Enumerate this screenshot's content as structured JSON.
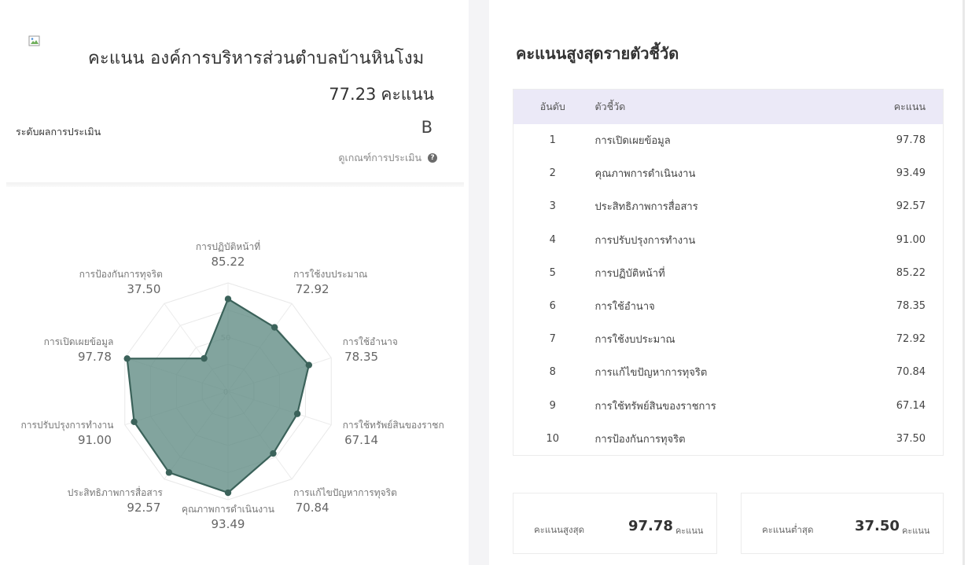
{
  "left": {
    "org_title": "คะแนน องค์การบริหารส่วนตำบลบ้านหินโงม",
    "score_value": "77.23",
    "score_unit": "คะแนน",
    "level_label": "ระดับผลการประเมิน",
    "level_value": "B",
    "criteria_link": "ดูเกณฑ์การประเมิน",
    "help_icon": "?"
  },
  "chart_data": {
    "type": "radar",
    "axes": [
      "การปฏิบัติหน้าที่",
      "การใช้งบประมาณ",
      "การใช้อำนาจ",
      "การใช้ทรัพย์สินของราชก",
      "การแก้ไขปัญหาการทุจริต",
      "คุณภาพการดำเนินงาน",
      "ประสิทธิภาพการสื่อสาร",
      "การปรับปรุงการทำงาน",
      "การเปิดเผยข้อมูล",
      "การป้องกันการทุจริต"
    ],
    "values": [
      85.22,
      72.92,
      78.35,
      67.14,
      70.84,
      93.49,
      92.57,
      91.0,
      97.78,
      37.5
    ],
    "value_labels": [
      "85.22",
      "72.92",
      "78.35",
      "67.14",
      "70.84",
      "93.49",
      "92.57",
      "91.00",
      "97.78",
      "37.50"
    ],
    "ticks": [
      "0",
      "50"
    ],
    "range": [
      0,
      100
    ],
    "fill_color": "#5f8a83",
    "stroke_color": "#3b625a"
  },
  "right": {
    "heading": "คะแนนสูงสุดรายตัวชี้วัด",
    "table": {
      "headers": [
        "อันดับ",
        "ตัวชี้วัด",
        "คะแนน"
      ],
      "rows": [
        [
          "1",
          "การเปิดเผยข้อมูล",
          "97.78"
        ],
        [
          "2",
          "คุณภาพการดำเนินงาน",
          "93.49"
        ],
        [
          "3",
          "ประสิทธิภาพการสื่อสาร",
          "92.57"
        ],
        [
          "4",
          "การปรับปรุงการทำงาน",
          "91.00"
        ],
        [
          "5",
          "การปฏิบัติหน้าที่",
          "85.22"
        ],
        [
          "6",
          "การใช้อำนาจ",
          "78.35"
        ],
        [
          "7",
          "การใช้งบประมาณ",
          "72.92"
        ],
        [
          "8",
          "การแก้ไขปัญหาการทุจริต",
          "70.84"
        ],
        [
          "9",
          "การใช้ทรัพย์สินของราชการ",
          "67.14"
        ],
        [
          "10",
          "การป้องกันการทุจริต",
          "37.50"
        ]
      ]
    },
    "max_box": {
      "label": "คะแนนสูงสุด",
      "value": "97.78",
      "unit": "คะแนน"
    },
    "min_box": {
      "label": "คะแนนต่ำสุด",
      "value": "37.50",
      "unit": "คะแนน"
    }
  }
}
